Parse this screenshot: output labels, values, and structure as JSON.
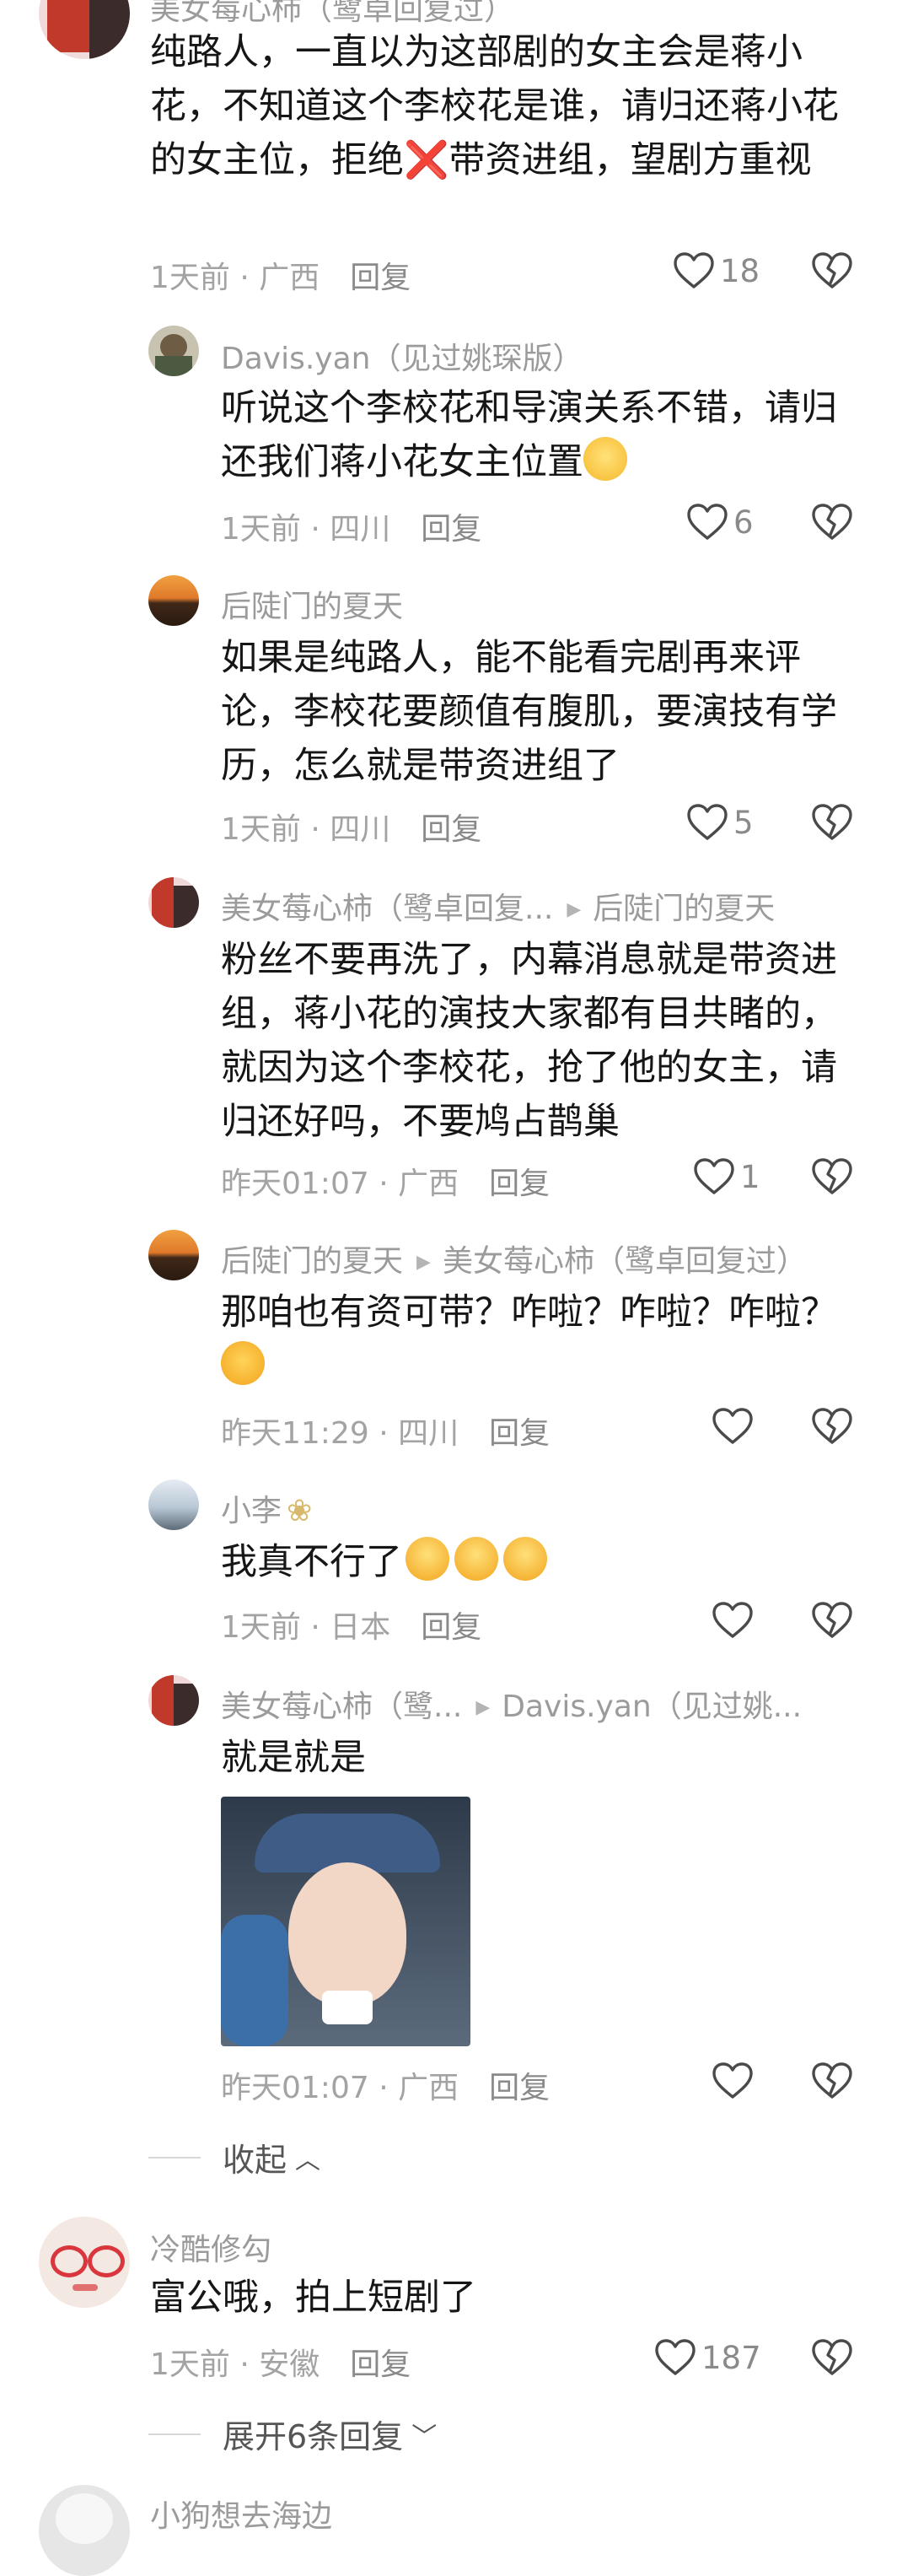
{
  "colors": {
    "text": "#161616",
    "meta": "#a3a3a3",
    "name": "#9b9b9b"
  },
  "comments": [
    {
      "name": "美女莓心柿（鹭卓回复过）",
      "text": "纯路人，一直以为这部剧的女主会是蒋小花，不知道这个李校花是谁，请归还蒋小花的女主位，拒绝❌带资进组，望剧方重视",
      "time": "1天前 · 广西",
      "reply": "回复",
      "likes": "18"
    },
    {
      "name": "Davis.yan（见过姚琛版）",
      "text": "听说这个李校花和导演关系不错，请归还我们蒋小花女主位置",
      "time": "1天前 · 四川",
      "reply": "回复",
      "likes": "6"
    },
    {
      "name": "后陡门的夏天",
      "text": "如果是纯路人，能不能看完剧再来评论，李校花要颜值有腹肌，要演技有学历，怎么就是带资进组了",
      "time": "1天前 · 四川",
      "reply": "回复",
      "likes": "5"
    },
    {
      "name": "美女莓心柿（鹭卓回复...",
      "reply_to": "后陡门的夏天",
      "text": "粉丝不要再洗了，内幕消息就是带资进组，蒋小花的演技大家都有目共睹的，就因为这个李校花，抢了他的女主，请归还好吗，不要鸠占鹊巢",
      "time": "昨天01:07 · 广西",
      "reply": "回复",
      "likes": "1"
    },
    {
      "name": "后陡门的夏天",
      "reply_to": "美女莓心柿（鹭卓回复过）",
      "text": "那咱也有资可带？咋啦？咋啦？咋啦？",
      "time": "昨天11:29 · 四川",
      "reply": "回复",
      "likes": ""
    },
    {
      "name": "小李",
      "text": "我真不行了",
      "time": "1天前 · 日本",
      "reply": "回复",
      "likes": ""
    },
    {
      "name": "美女莓心柿（鹭...",
      "reply_to": "Davis.yan（见过姚...",
      "text": "就是就是",
      "time": "昨天01:07 · 广西",
      "reply": "回复",
      "likes": ""
    },
    {
      "name": "冷酷修勾",
      "text": "富公哦，拍上短剧了",
      "time": "1天前 · 安徽",
      "reply": "回复",
      "likes": "187"
    },
    {
      "name": "小狗想去海边"
    }
  ],
  "collapse_label": "收起",
  "expand_label": "展开6条回复"
}
